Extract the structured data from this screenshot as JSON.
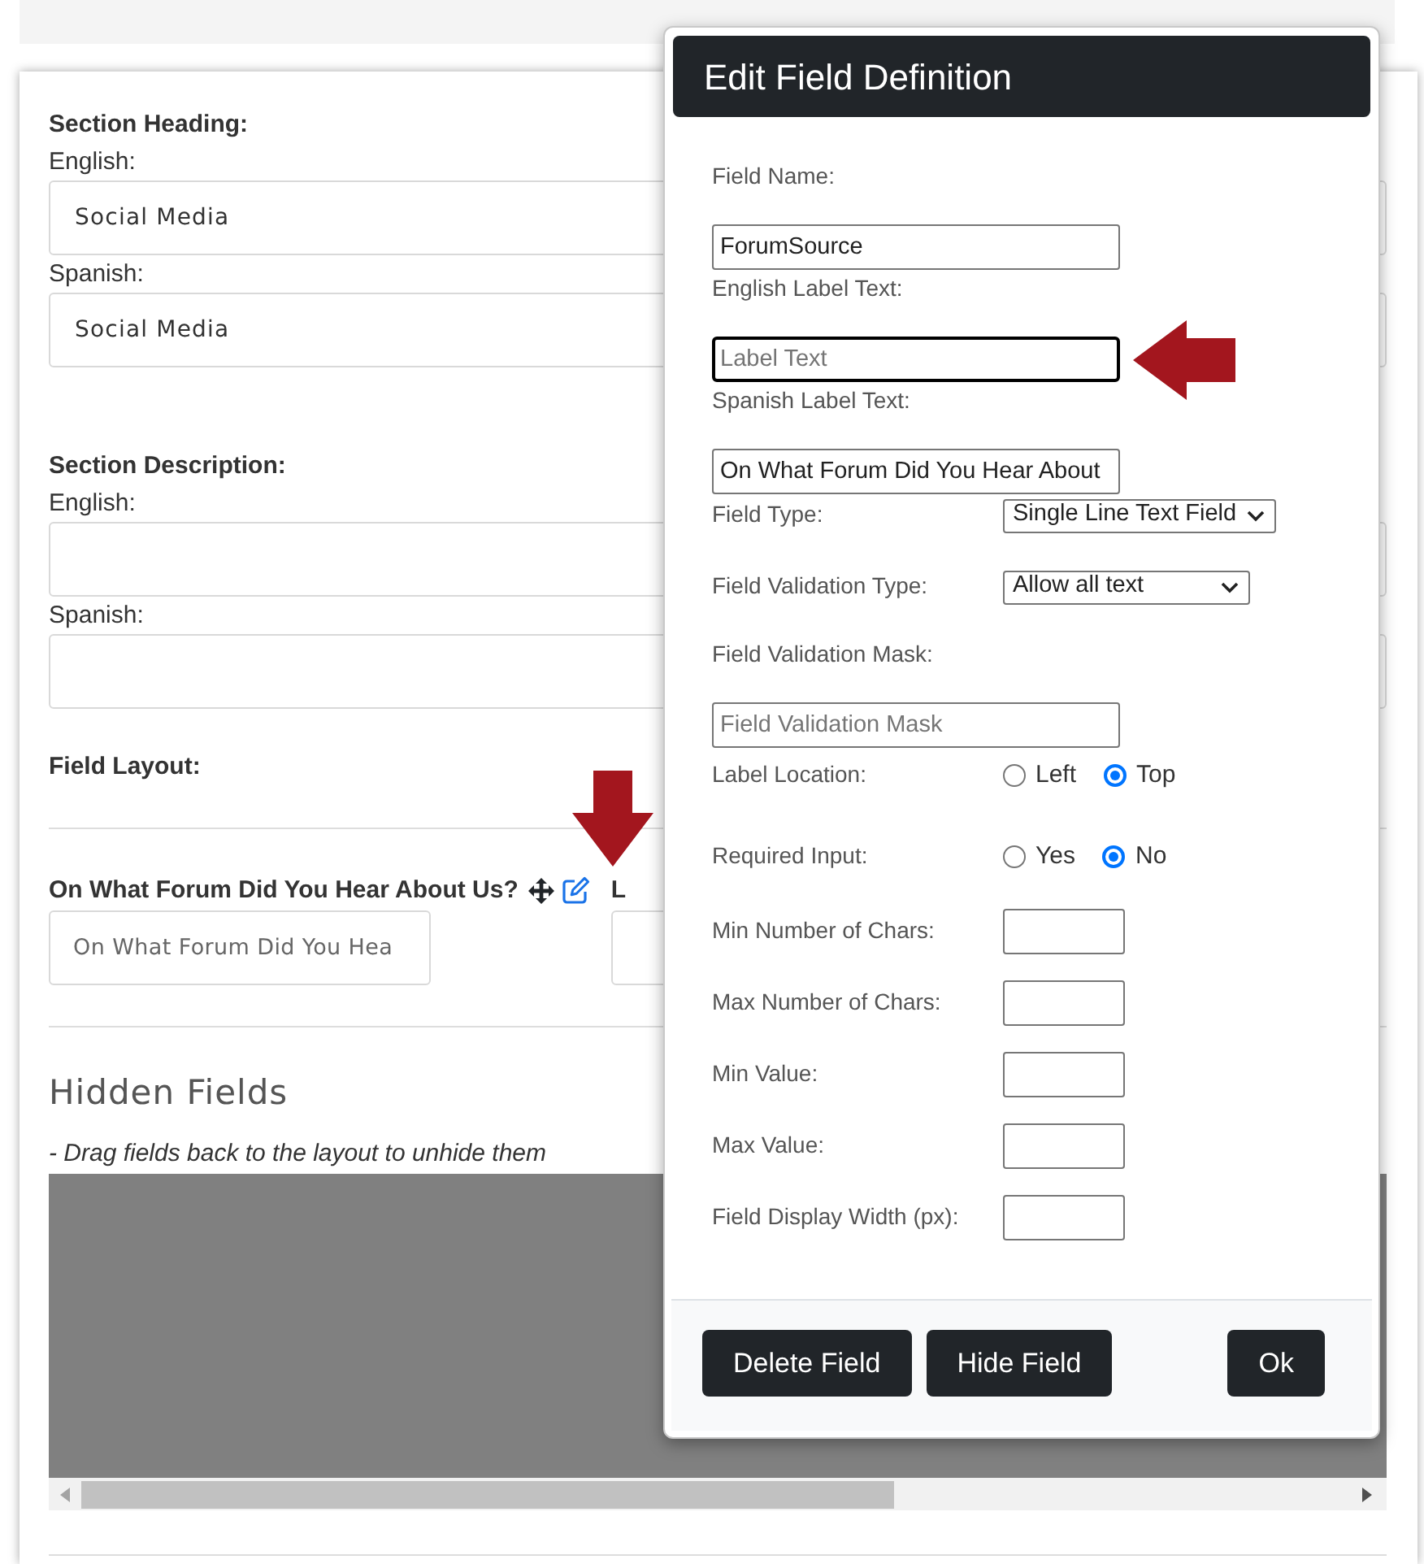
{
  "section_heading": {
    "title": "Section Heading:",
    "fields": [
      {
        "label": "English:",
        "value": "Social Media"
      },
      {
        "label": "Spanish:",
        "value": "Social Media"
      }
    ]
  },
  "section_description": {
    "title": "Section Description:",
    "fields": [
      {
        "label": "English:"
      },
      {
        "label": "Spanish:"
      }
    ]
  },
  "field_layout": {
    "title": "Field Layout:",
    "fields": [
      {
        "label": "On What Forum Did You Hear About Us?",
        "tools": [
          {
            "kind": "move"
          },
          {
            "kind": "edit"
          }
        ],
        "value": "On What Forum Did You Hea"
      },
      {
        "label": "L"
      }
    ]
  },
  "hidden_fields": {
    "title": "Hidden Fields",
    "hint": "- Drag fields back to the layout to unhide them"
  },
  "dialog": {
    "title": "Edit Field Definition",
    "rows": [
      {
        "kind": "text",
        "label": "Field Name:",
        "value": "ForumSource",
        "focused": false
      },
      {
        "kind": "text",
        "label": "English Label Text:",
        "placeholder": "Label Text",
        "focused": true
      },
      {
        "kind": "text",
        "label": "Spanish Label Text:",
        "value": "On What Forum Did You Hear About",
        "focused": false
      },
      {
        "kind": "select",
        "label": "Field Type:",
        "value": "Single Line Text Field"
      },
      {
        "kind": "select",
        "label": "Field Validation Type:",
        "value": "Allow all text"
      },
      {
        "kind": "text",
        "label": "Field Validation Mask:",
        "placeholder": "Field Validation Mask",
        "focused": false
      },
      {
        "kind": "radio",
        "label": "Label Location:",
        "options": [
          {
            "label": "Left",
            "selected": false
          },
          {
            "label": "Top",
            "selected": true
          }
        ]
      },
      {
        "kind": "radio",
        "label": "Required Input:",
        "options": [
          {
            "label": "Yes",
            "selected": false
          },
          {
            "label": "No",
            "selected": true
          }
        ]
      },
      {
        "kind": "number",
        "label": "Min Number of Chars:"
      },
      {
        "kind": "number",
        "label": "Max Number of Chars:"
      },
      {
        "kind": "number",
        "label": "Min Value:"
      },
      {
        "kind": "number",
        "label": "Max Value:"
      },
      {
        "kind": "number",
        "label": "Field Display Width (px):"
      }
    ],
    "buttons": [
      {
        "label": "Delete Field"
      },
      {
        "label": "Hide Field"
      },
      {
        "label": "Ok"
      }
    ]
  }
}
